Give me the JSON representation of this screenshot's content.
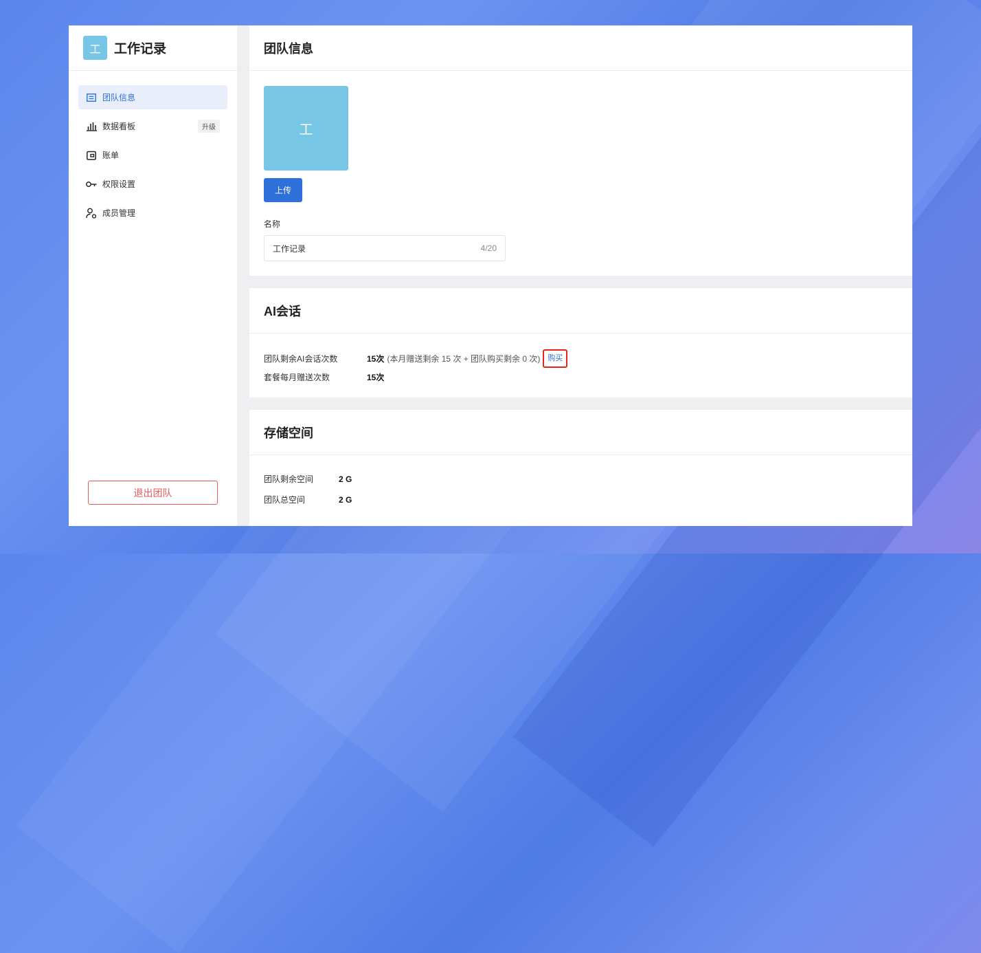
{
  "sidebar": {
    "team_avatar_letter": "工",
    "team_name": "工作记录",
    "items": [
      {
        "label": "团队信息",
        "icon": "list-icon",
        "active": true
      },
      {
        "label": "数据看板",
        "icon": "bar-chart-icon",
        "badge": "升级"
      },
      {
        "label": "账单",
        "icon": "wallet-icon"
      },
      {
        "label": "权限设置",
        "icon": "key-icon"
      },
      {
        "label": "成员管理",
        "icon": "user-settings-icon"
      }
    ],
    "leave_label": "退出团队"
  },
  "team_info": {
    "title": "团队信息",
    "avatar_letter": "工",
    "upload_label": "上传",
    "name_label": "名称",
    "name_value": "工作记录",
    "name_counter": "4/20"
  },
  "ai_chat": {
    "title": "AI会话",
    "remaining_label": "团队剩余AI会话次数",
    "remaining_value": "15次",
    "remaining_note": "(本月赠送剩余 15 次 + 团队购买剩余 0 次)",
    "buy_label": "购买",
    "monthly_label": "套餐每月赠送次数",
    "monthly_value": "15次"
  },
  "storage": {
    "title": "存储空间",
    "remaining_label": "团队剩余空间",
    "remaining_value": "2 G",
    "total_label": "团队总空间",
    "total_value": "2 G"
  },
  "colors": {
    "accent": "#2f6fd9",
    "avatar": "#78c6e6",
    "danger": "#e55a5a",
    "highlight_box": "#e8231b"
  }
}
